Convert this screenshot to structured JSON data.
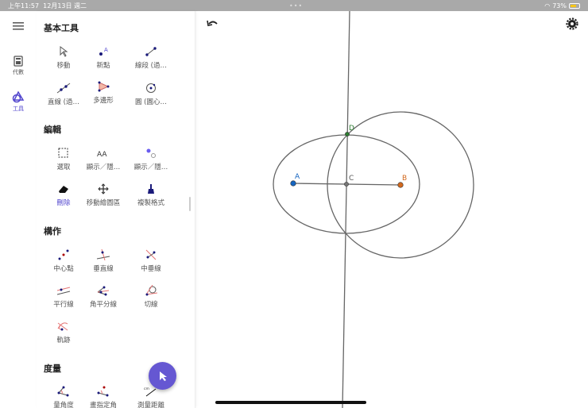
{
  "status": {
    "time": "上午11:57",
    "date": "12月13日 週二",
    "battery": "73%",
    "battery_level": 0.73
  },
  "rail": {
    "algebra": "代數",
    "tools": "工具"
  },
  "sections": {
    "basic": {
      "title": "基本工具",
      "tools": [
        "移動",
        "新點",
        "線段 (過…",
        "直線 (過…",
        "多邊形",
        "圓 (圓心…"
      ]
    },
    "edit": {
      "title": "編輯",
      "tools": [
        "選取",
        "顯示／隱…",
        "顯示／隱…",
        "刪除",
        "移動繪圖區",
        "複製格式"
      ]
    },
    "construct": {
      "title": "構作",
      "tools": [
        "中心點",
        "垂直線",
        "中垂線",
        "平行線",
        "角平分線",
        "切線",
        "軌跡"
      ]
    },
    "measure": {
      "title": "度量",
      "tools": [
        "量角度",
        "畫指定角",
        "測量距離"
      ]
    }
  },
  "points": {
    "A": "A",
    "B": "B",
    "C": "C",
    "D": "D"
  },
  "colors": {
    "accent": "#5145cd",
    "A": "#1565c0",
    "B": "#d2691e",
    "D": "#2e7d32"
  }
}
